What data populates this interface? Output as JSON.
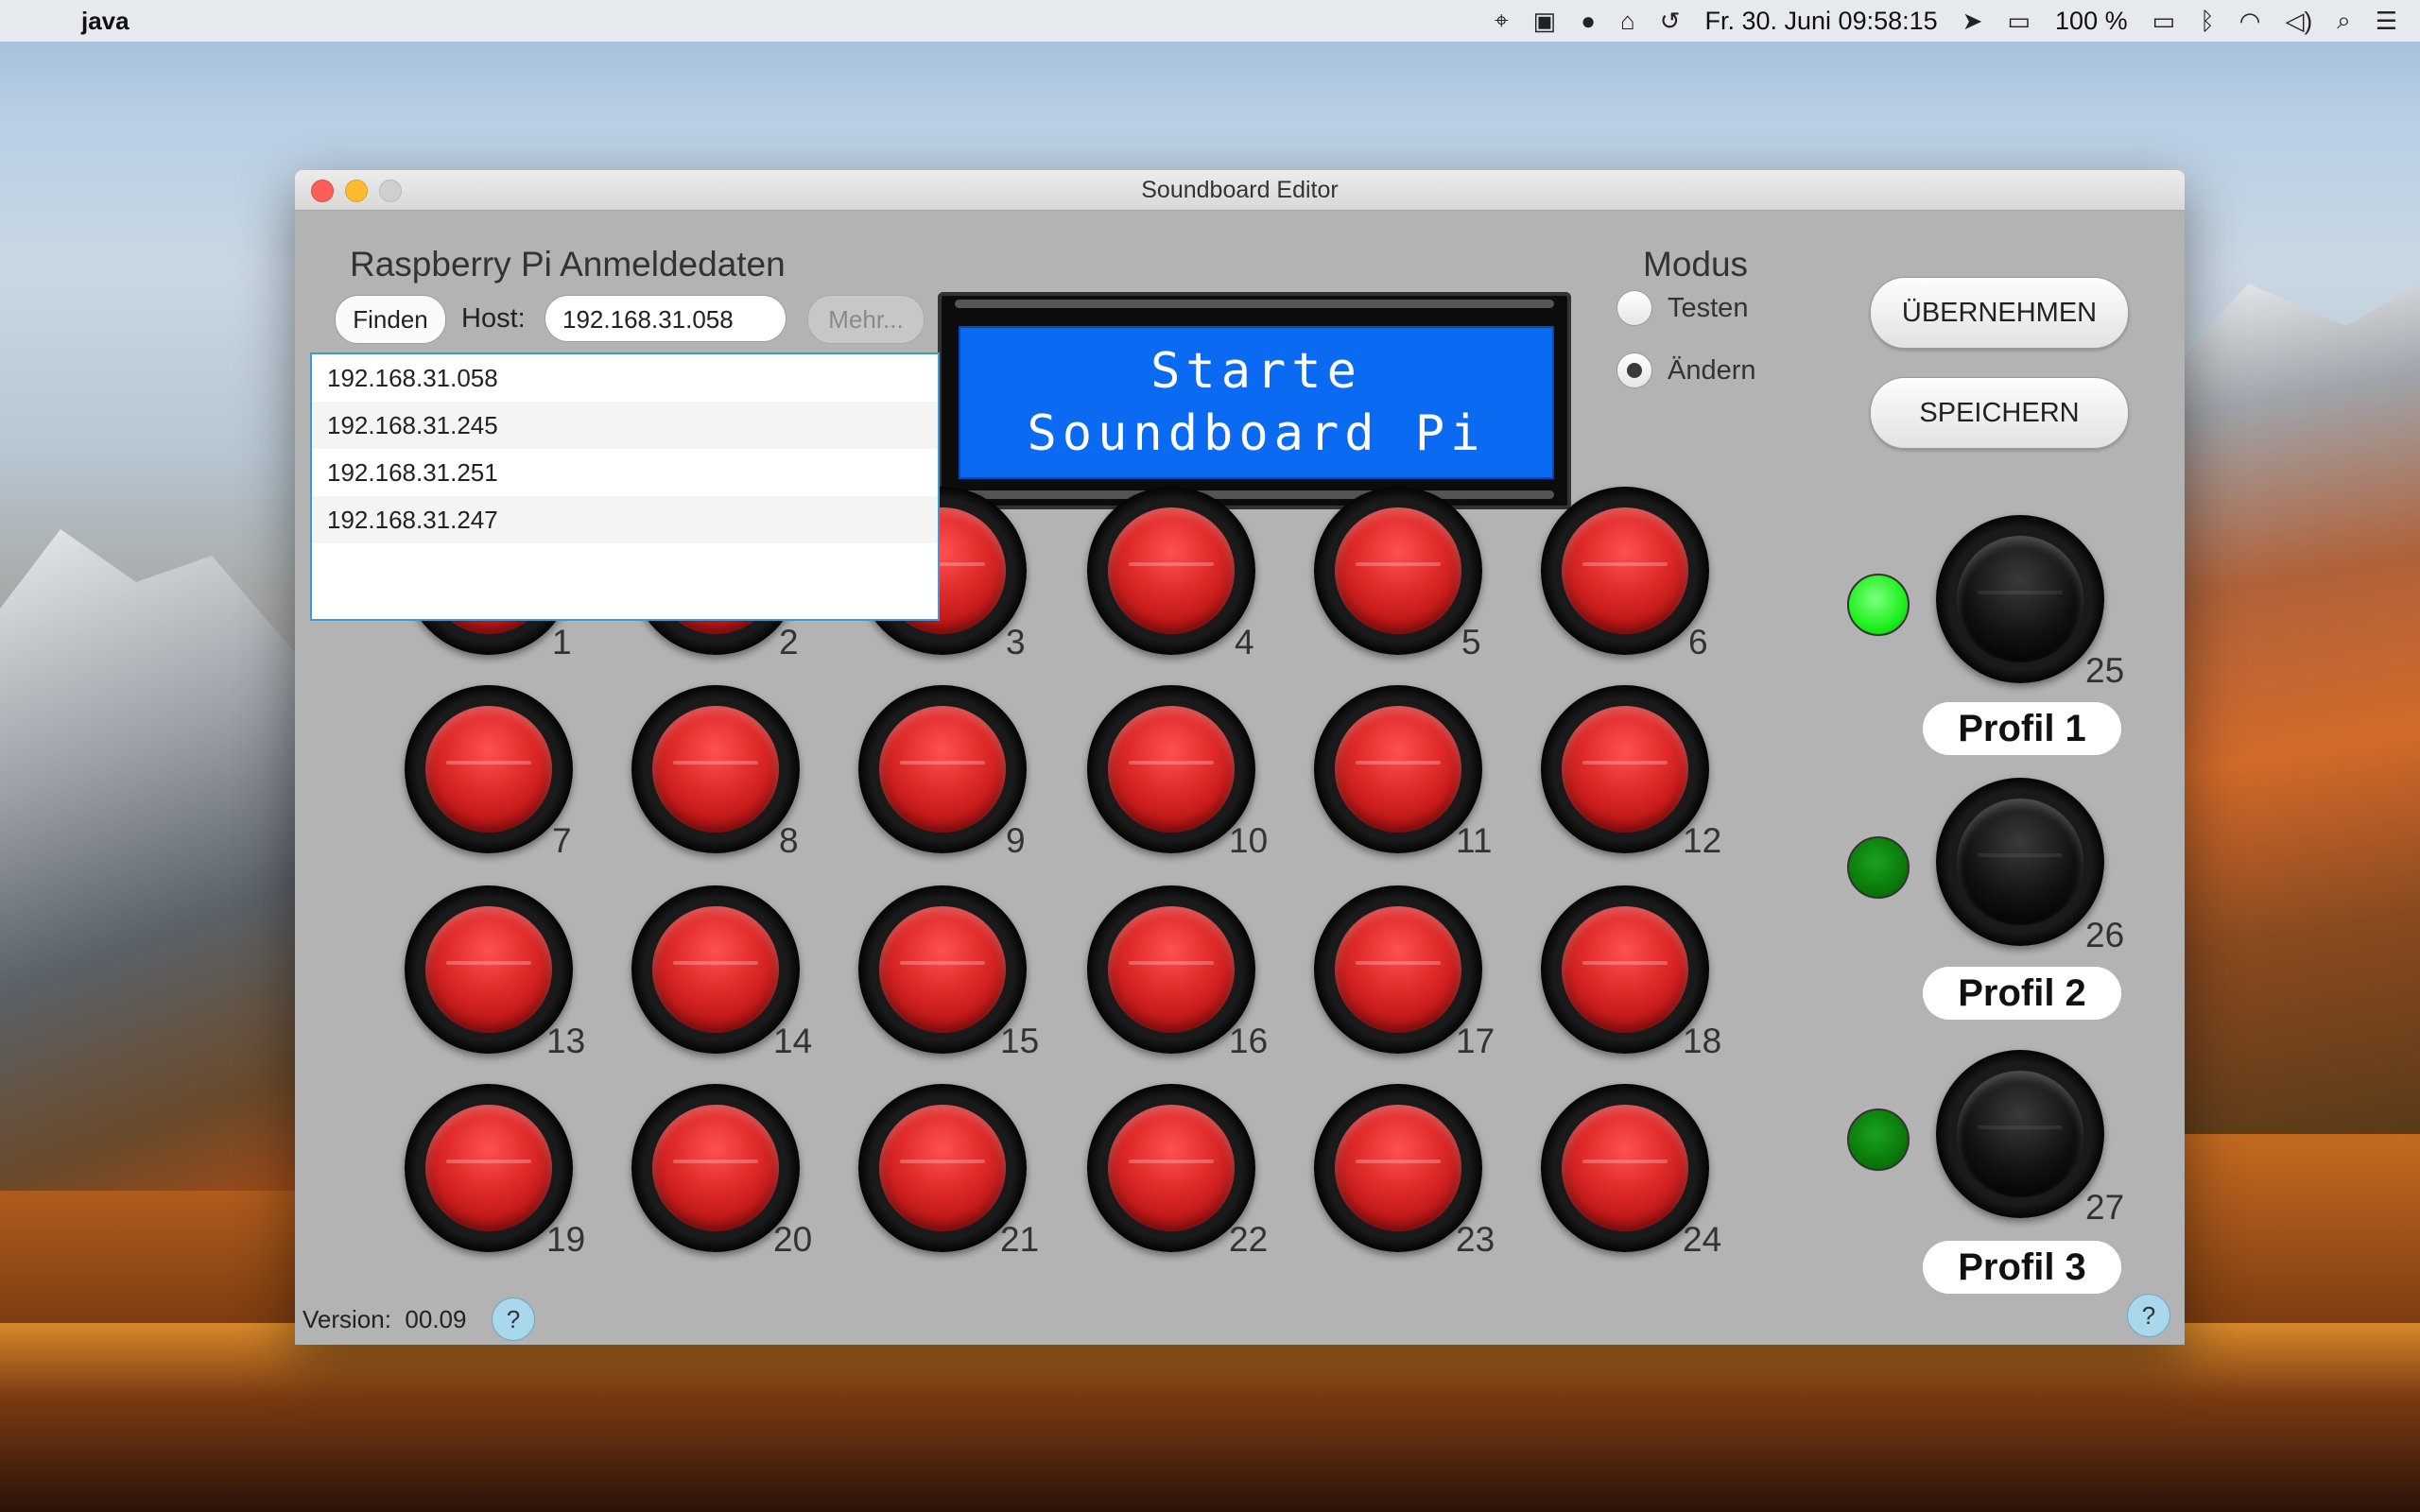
{
  "menubar": {
    "app_name": "java",
    "datetime": "Fr. 30. Juni  09:58:15",
    "battery": "100 %",
    "icons": [
      "apple-icon",
      "location-icon",
      "airplay-display-icon",
      "circle-icon",
      "train-icon",
      "time-machine-icon",
      "location-arrow-icon",
      "airplay-icon",
      "battery-icon",
      "bluetooth-icon",
      "wifi-icon",
      "volume-icon",
      "search-icon",
      "list-icon"
    ]
  },
  "window": {
    "title": "Soundboard Editor"
  },
  "credentials": {
    "heading": "Raspberry Pi Anmeldedaten",
    "find_label": "Finden",
    "host_label": "Host:",
    "host_value": "192.168.31.058",
    "more_label": "Mehr...",
    "hosts": [
      "192.168.31.058",
      "192.168.31.245",
      "192.168.31.251",
      "192.168.31.247"
    ]
  },
  "lcd": {
    "line1": "Starte",
    "line2": "Soundboard Pi"
  },
  "modus": {
    "title": "Modus",
    "options": [
      {
        "label": "Testen",
        "selected": false
      },
      {
        "label": "Ändern",
        "selected": true
      }
    ]
  },
  "actions": {
    "apply_label": "ÜBERNEHMEN",
    "save_label": "SPEICHERN"
  },
  "sound_buttons": [
    "1",
    "2",
    "3",
    "4",
    "5",
    "6",
    "7",
    "8",
    "9",
    "10",
    "11",
    "12",
    "13",
    "14",
    "15",
    "16",
    "17",
    "18",
    "19",
    "20",
    "21",
    "22",
    "23",
    "24"
  ],
  "profiles": [
    {
      "number": "25",
      "label": "Profil 1",
      "led": "on",
      "led_color": "#1ef11e"
    },
    {
      "number": "26",
      "label": "Profil 2",
      "led": "off",
      "led_color": "#0a7a0a"
    },
    {
      "number": "27",
      "label": "Profil 3",
      "led": "off",
      "led_color": "#0a7a0a"
    }
  ],
  "footer": {
    "version_label": "Version:",
    "version_value": "00.09",
    "help_label": "?"
  },
  "colors": {
    "lcd_background": "#0b6af2",
    "button_red": "#e02a2a",
    "window_background": "#b3b3b3"
  }
}
